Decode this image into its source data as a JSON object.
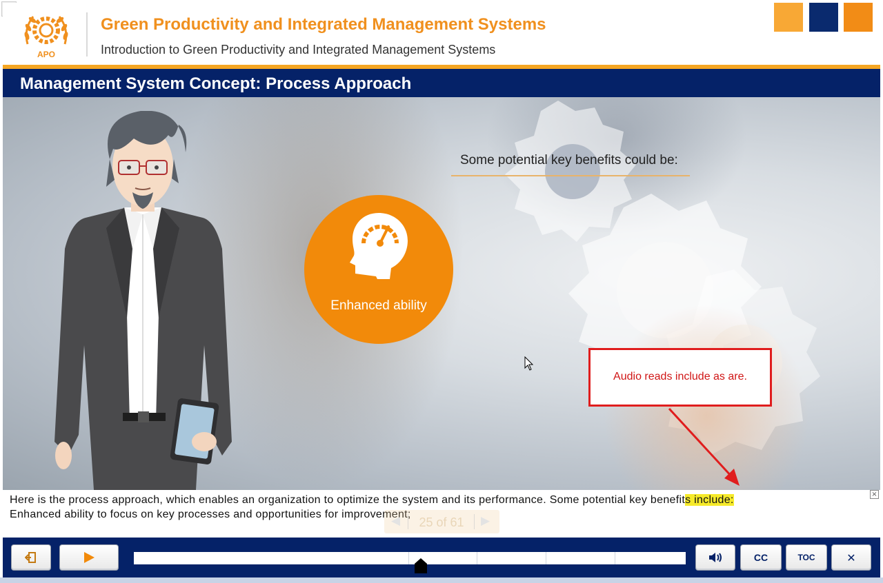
{
  "header": {
    "course_title": "Green Productivity and Integrated Management Systems",
    "course_subtitle": "Introduction to Green Productivity and Integrated Management Systems",
    "logo_text": "APO",
    "expand_glyph": "»"
  },
  "slide": {
    "title": "Management System Concept: Process Approach",
    "benefits_heading": "Some potential key benefits could be:",
    "benefit_label": "Enhanced ability",
    "annotation_text": "Audio reads include as are."
  },
  "captions": {
    "text_before": "Here is the process approach, which enables an organization to optimize the system and its performance. Some potential key benefit",
    "text_highlight": "s include:",
    "text_after": "Enhanced ability to focus on key processes and opportunities for improvement;",
    "close_glyph": "×"
  },
  "navigation": {
    "prev_glyph": "◀",
    "next_glyph": "▶",
    "counter": "25 of 61",
    "current_slide": 25,
    "total_slides": 61
  },
  "controls": {
    "cc_label": "CC",
    "toc_label": "TOC",
    "exit_glyph": "✕",
    "play_state": "paused",
    "playback_progress": 0.52
  },
  "colors": {
    "brand_orange": "#f0901e",
    "brand_navy": "#052268",
    "annotation_red": "#e01d1d",
    "highlight_yellow": "#f6ea2a"
  },
  "icons": [
    "logo-icon",
    "head-gauge-icon",
    "cursor-icon",
    "exit-door-icon",
    "play-icon",
    "volume-icon",
    "close-icon",
    "expand-icon"
  ]
}
